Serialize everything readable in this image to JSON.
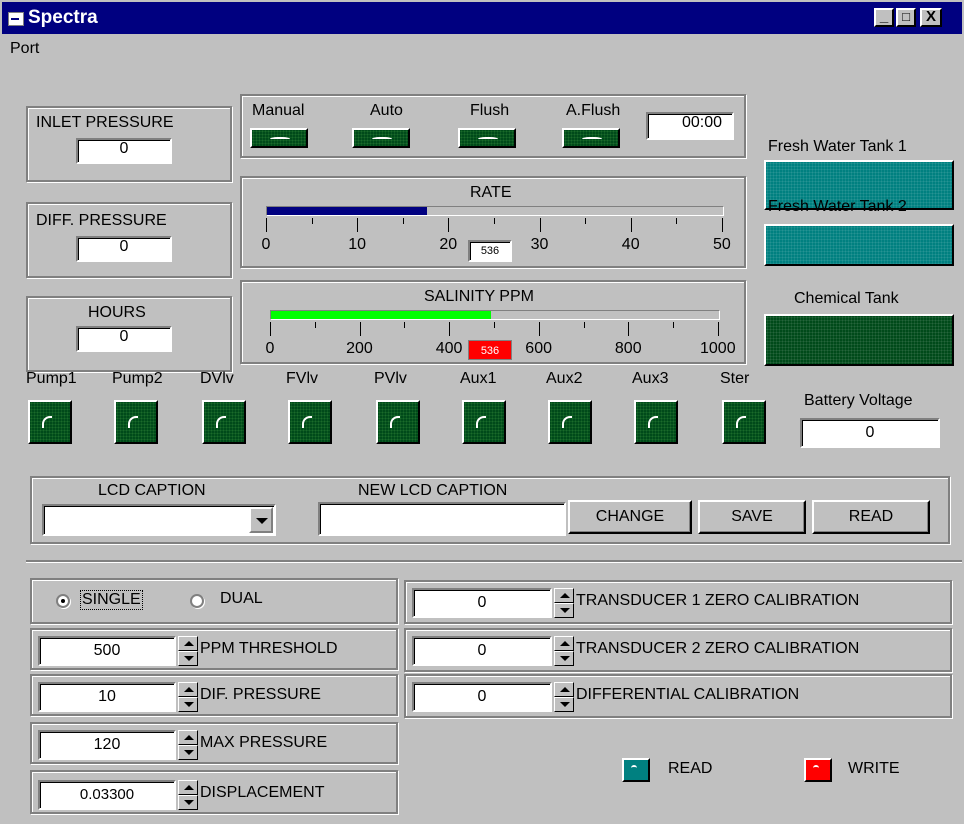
{
  "window": {
    "title": "Spectra",
    "min": "_",
    "max": "□",
    "close": "X"
  },
  "menu": {
    "port": "Port"
  },
  "inlet_pressure": {
    "label": "INLET PRESSURE",
    "value": "0"
  },
  "diff_pressure": {
    "label": "DIFF.  PRESSURE",
    "value": "0"
  },
  "hours": {
    "label": "HOURS",
    "value": "0"
  },
  "modes": {
    "manual": "Manual",
    "auto": "Auto",
    "flush": "Flush",
    "aflush": "A.Flush",
    "timer": "00:00"
  },
  "rate": {
    "title": "RATE",
    "value": "536",
    "fraction": 0.35,
    "fill_color": "#000080",
    "ticks": [
      "0",
      "10",
      "20",
      "30",
      "40",
      "50"
    ]
  },
  "salinity": {
    "title": "SALINITY PPM",
    "value": "536",
    "fraction": 0.49,
    "fill_color": "#00ff00",
    "badge_color": "#ff0000",
    "ticks": [
      "0",
      "200",
      "400",
      "600",
      "800",
      "1000"
    ]
  },
  "tanks": {
    "fresh1": "Fresh Water Tank 1",
    "fresh2": "Fresh Water Tank 2",
    "chemical": "Chemical Tank",
    "fresh_color": "#008080",
    "chem_color": "#004a1a"
  },
  "outputs": [
    "Pump1",
    "Pump2",
    "DVlv",
    "FVlv",
    "PVlv",
    "Aux1",
    "Aux2",
    "Aux3",
    "Ster"
  ],
  "battery": {
    "label": "Battery Voltage",
    "value": "0"
  },
  "lcd": {
    "caption_label": "LCD CAPTION",
    "new_caption_label": "NEW LCD CAPTION",
    "caption_value": "",
    "new_caption_value": "",
    "change": "CHANGE",
    "save": "SAVE",
    "read": "READ"
  },
  "mode_select": {
    "single": "SINGLE",
    "dual": "DUAL",
    "selected": "single"
  },
  "settings": {
    "ppm_threshold": {
      "value": "500",
      "label": "PPM THRESHOLD"
    },
    "dif_pressure": {
      "value": "10",
      "label": "DIF. PRESSURE"
    },
    "max_pressure": {
      "value": "120",
      "label": "MAX PRESSURE"
    },
    "displacement": {
      "value": "0.03300",
      "label": "DISPLACEMENT"
    }
  },
  "calibration": {
    "t1": {
      "value": "0",
      "label": "TRANSDUCER 1 ZERO CALIBRATION"
    },
    "t2": {
      "value": "0",
      "label": "TRANSDUCER 2 ZERO CALIBRATION"
    },
    "diff": {
      "value": "0",
      "label": "DIFFERENTIAL CALIBRATION"
    }
  },
  "status": {
    "read": "READ",
    "write": "WRITE",
    "read_color": "#008080",
    "write_color": "#ff0000"
  }
}
